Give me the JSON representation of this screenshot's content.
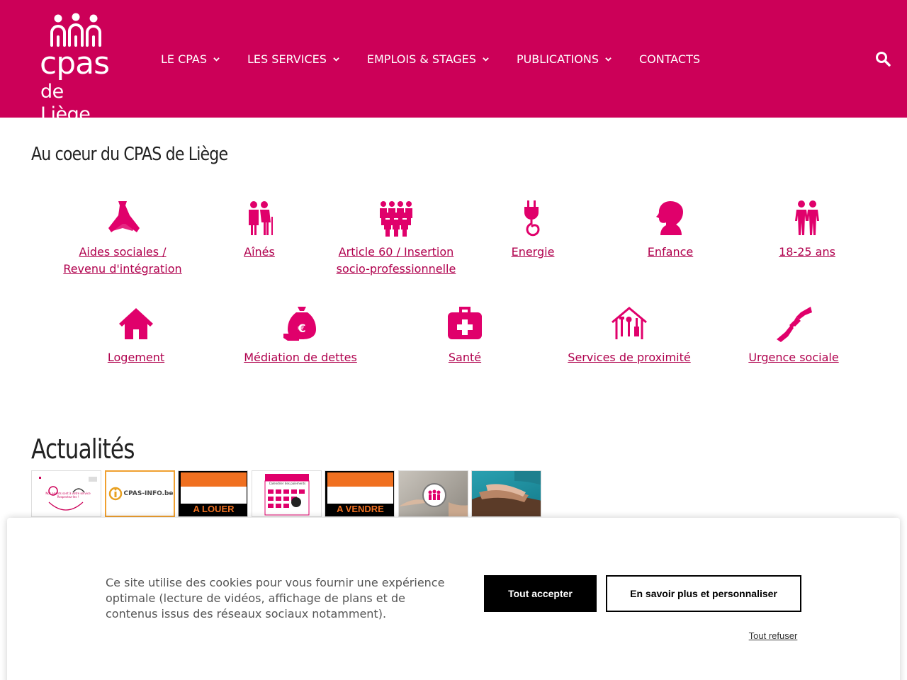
{
  "header": {
    "logo": {
      "line1": "cpas",
      "line2": "de Liège"
    },
    "nav": [
      {
        "label": "LE CPAS",
        "has_dropdown": true
      },
      {
        "label": "LES SERVICES",
        "has_dropdown": true
      },
      {
        "label": "EMPLOIS & STAGES",
        "has_dropdown": true
      },
      {
        "label": "PUBLICATIONS",
        "has_dropdown": true
      },
      {
        "label": "CONTACTS",
        "has_dropdown": false
      }
    ],
    "search_icon": "search-icon"
  },
  "services": {
    "title": "Au coeur du CPAS de Liège",
    "row1": [
      {
        "label": "Aides sociales /\nRevenu d'intégration",
        "icon": "hands-icon"
      },
      {
        "label": "Aînés",
        "icon": "elderly-icon"
      },
      {
        "label": "Article 60 / Insertion\nsocio-professionnelle",
        "icon": "team-icon"
      },
      {
        "label": "Energie",
        "icon": "plug-icon"
      },
      {
        "label": "Enfance",
        "icon": "child-icon"
      },
      {
        "label": "18-25 ans",
        "icon": "youth-icon"
      }
    ],
    "row2": [
      {
        "label": "Logement",
        "icon": "house-icon"
      },
      {
        "label": "Médiation de dettes",
        "icon": "money-bag-icon"
      },
      {
        "label": "Santé",
        "icon": "medical-kit-icon"
      },
      {
        "label": "Services de proximité",
        "icon": "tools-house-icon"
      },
      {
        "label": "Urgence sociale",
        "icon": "helping-hand-icon"
      }
    ]
  },
  "news": {
    "title": "Actualités",
    "thumbs": [
      {
        "caption": "Nos agents sont à votre service\nRespectez-les !"
      },
      {
        "caption": "CPAS-INFO.be"
      },
      {
        "caption": "A LOUER"
      },
      {
        "caption": "Calendrier des paiements"
      },
      {
        "caption": "A VENDRE"
      },
      {
        "caption": ""
      },
      {
        "caption": ""
      }
    ]
  },
  "cookie": {
    "text": "Ce site utilise des cookies pour vous fournir une expérience optimale (lecture de vidéos, affichage de plans et de contenus issus des réseaux sociaux notamment).",
    "accept": "Tout accepter",
    "more": "En savoir plus et personnaliser",
    "refuse": "Tout refuser"
  },
  "colors": {
    "brand": "#cc0058",
    "link": "#b0004d",
    "icon": "#e0006b"
  }
}
